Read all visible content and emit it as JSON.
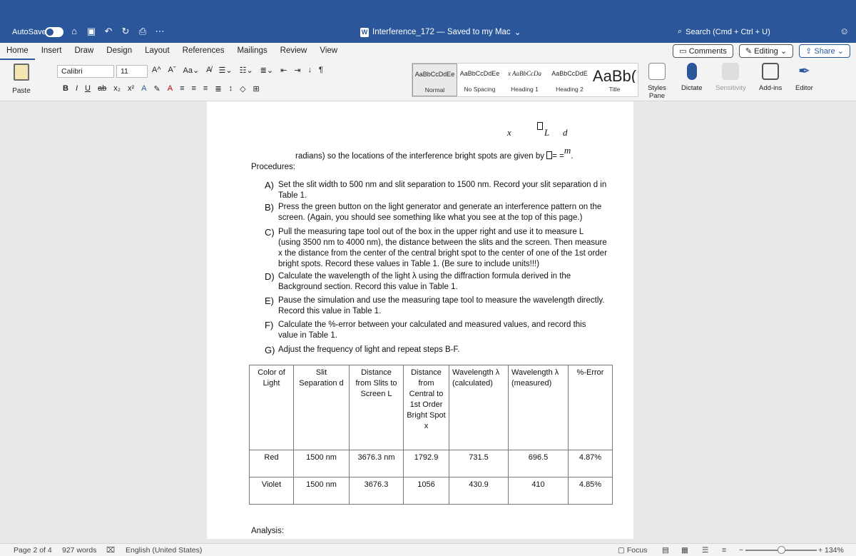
{
  "titlebar": {
    "autosave_label": "AutoSave",
    "doc_title": "Interference_172 — Saved to my Mac",
    "search_placeholder": "Search (Cmd + Ctrl + U)"
  },
  "tabs": [
    "Home",
    "Insert",
    "Draw",
    "Design",
    "Layout",
    "References",
    "Mailings",
    "Review",
    "View"
  ],
  "tabs_right": {
    "comments": "Comments",
    "editing": "Editing",
    "share": "Share"
  },
  "ribbon": {
    "paste": "Paste",
    "font_name": "Calibri",
    "font_size": "11",
    "styles": [
      {
        "sample": "AaBbCcDdEe",
        "name": "Normal"
      },
      {
        "sample": "AaBbCcDdEe",
        "name": "No Spacing"
      },
      {
        "sample": "x AaBbCcDa",
        "name": "Heading 1"
      },
      {
        "sample": "AaBbCcDdE",
        "name": "Heading 2"
      },
      {
        "sample": "AaBb(",
        "name": "Title"
      }
    ],
    "styles_pane": "Styles Pane",
    "dictate": "Dictate",
    "sensitivity": "Sensitivity",
    "addins": "Add-ins",
    "editor": "Editor"
  },
  "document": {
    "formula_top": "x",
    "formula_L": "L",
    "formula_d": "d",
    "formula_m": "m",
    "intro_line": "radians) so the locations of the interference bright spots are given by",
    "procedures_label": "Procedures:",
    "steps": [
      {
        "letter": "A)",
        "text": "Set the slit width to 500 nm and slit separation to 1500 nm.  Record your slit separation d in Table 1."
      },
      {
        "letter": "B)",
        "text": "Press the green button on the light generator and generate an interference pattern on the screen.  (Again, you should see something like what you see at the top of this page.)"
      },
      {
        "letter": "C)",
        "text": "Pull the measuring tape tool out of the box in the upper right and use it to measure L (using 3500 nm to 4000 nm), the distance between the slits and the screen.  Then measure x the distance from the center of the central bright spot to the center of one of the 1st order bright spots.  Record these values in Table 1.  (Be sure to include units!!!)"
      },
      {
        "letter": "D)",
        "text": "Calculate the wavelength of the light λ using the diffraction formula derived in the Background section.  Record this value in Table 1."
      },
      {
        "letter": "E)",
        "text": "Pause the simulation and use the measuring tape tool to measure the wavelength directly.  Record this value in Table 1."
      },
      {
        "letter": "F)",
        "text": "Calculate the %-error between your calculated and measured values, and record this value in Table 1."
      },
      {
        "letter": "G)",
        "text": "Adjust the frequency of light and repeat steps B-F."
      }
    ],
    "table_headers": [
      "Color of Light",
      "Slit Separation d",
      "Distance from Slits to Screen L",
      "Distance from Central to 1st Order Bright Spot x",
      "Wavelength λ (calculated)",
      "Wavelength λ (measured)",
      "%-Error"
    ],
    "table_rows": [
      [
        "Red",
        "1500 nm",
        "3676.3 nm",
        "1792.9",
        "731.5",
        "696.5",
        "4.87%"
      ],
      [
        "Violet",
        "1500 nm",
        "3676.3",
        "1056",
        "430.9",
        "410",
        "4.85%"
      ]
    ],
    "analysis_label": "Analysis:"
  },
  "statusbar": {
    "page": "Page 2 of 4",
    "words": "927 words",
    "language": "English (United States)",
    "focus": "Focus",
    "zoom": "134%"
  }
}
